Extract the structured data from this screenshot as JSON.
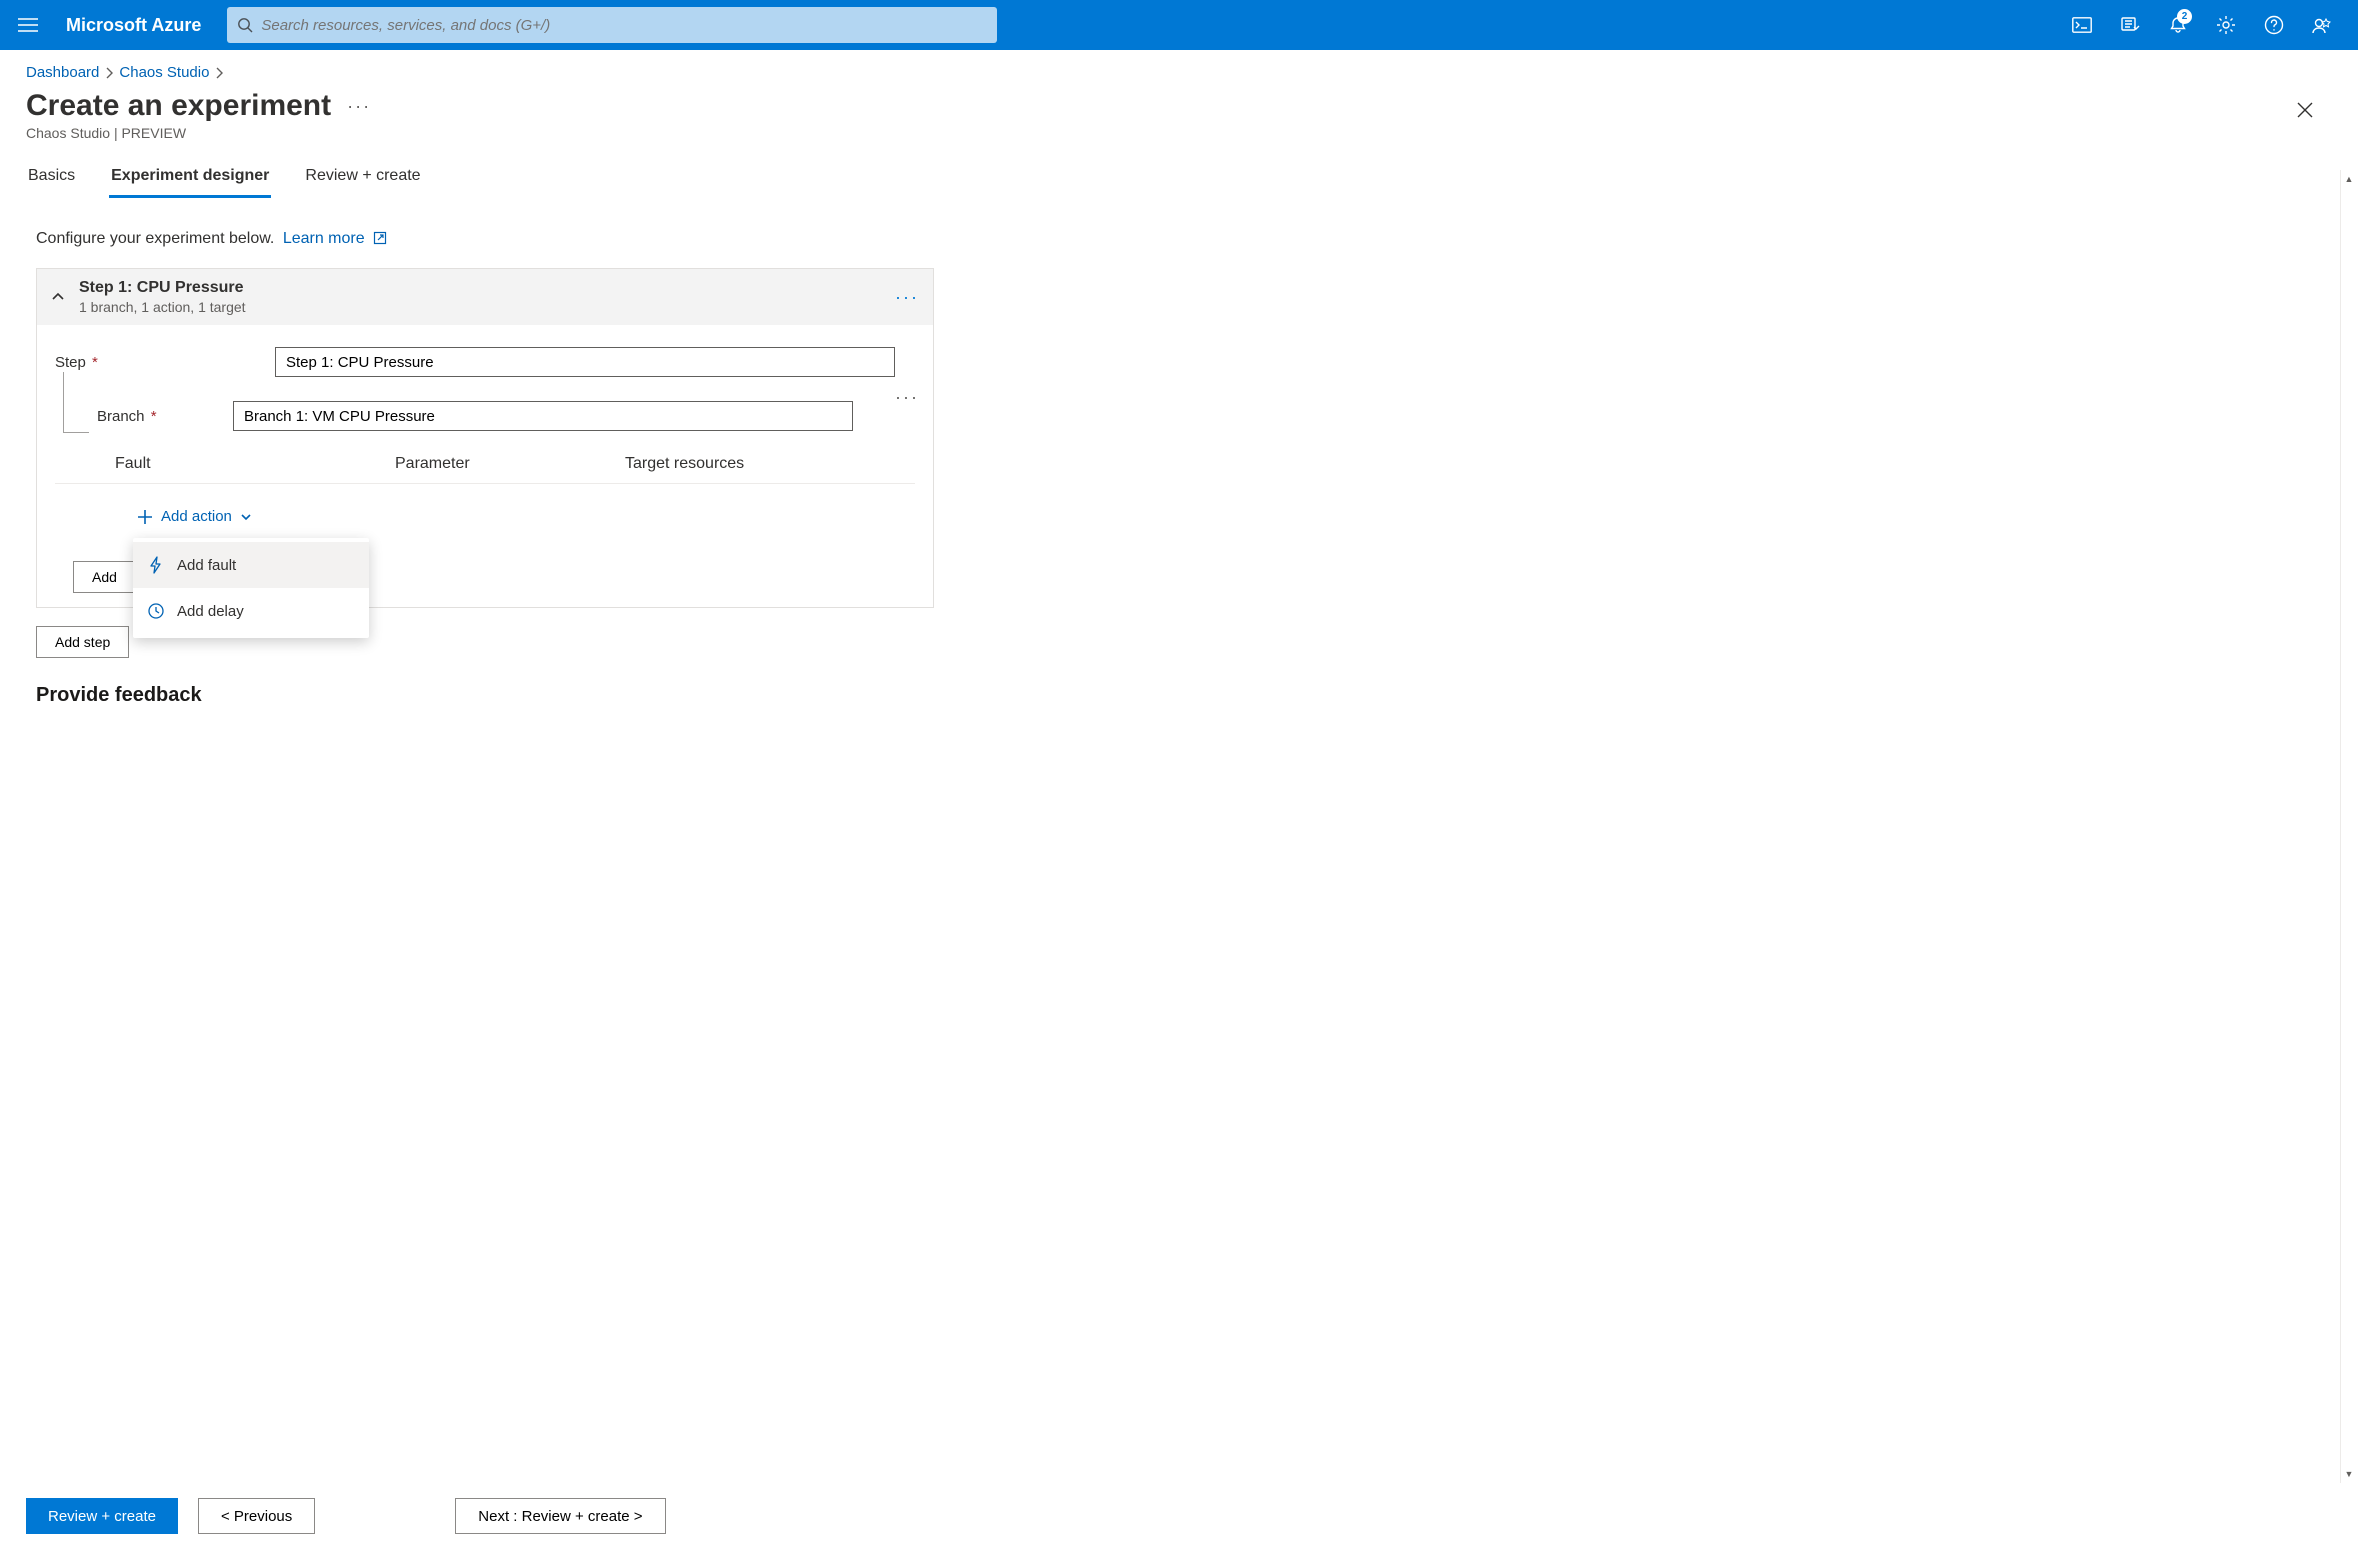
{
  "brand": "Microsoft Azure",
  "search_placeholder": "Search resources, services, and docs (G+/)",
  "notification_count": "2",
  "breadcrumb": [
    "Dashboard",
    "Chaos Studio"
  ],
  "page": {
    "title": "Create an experiment",
    "subtitle": "Chaos Studio | PREVIEW"
  },
  "tabs": [
    {
      "label": "Basics",
      "active": false
    },
    {
      "label": "Experiment designer",
      "active": true
    },
    {
      "label": "Review + create",
      "active": false
    }
  ],
  "intro_text": "Configure your experiment below.",
  "intro_link": "Learn more",
  "step1": {
    "header_title": "Step 1: CPU Pressure",
    "header_sub": "1 branch, 1 action, 1 target",
    "step_label": "Step",
    "step_value": "Step 1: CPU Pressure",
    "branch_label": "Branch",
    "branch_value": "Branch 1: VM CPU Pressure",
    "col_fault": "Fault",
    "col_parameter": "Parameter",
    "col_targets": "Target resources",
    "add_action": "Add action",
    "dd_fault": "Add fault",
    "dd_delay": "Add delay",
    "add_branch_truncated": "Add"
  },
  "add_step": "Add step",
  "feedback_heading": "Provide feedback",
  "footer": {
    "review": "Review + create",
    "prev": "< Previous",
    "next": "Next : Review + create >"
  }
}
